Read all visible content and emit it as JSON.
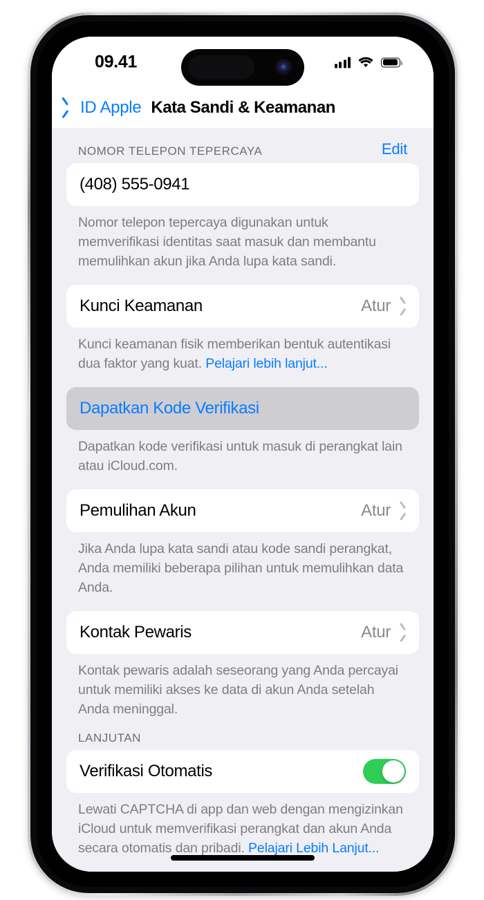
{
  "status_bar": {
    "time": "09.41",
    "icons": [
      "cellular-signal-icon",
      "wifi-icon",
      "battery-icon"
    ]
  },
  "nav_bar": {
    "back_label": "ID Apple",
    "title": "Kata Sandi & Keamanan"
  },
  "sections": {
    "trusted_phone": {
      "header": "NOMOR TELEPON TEPERCAYA",
      "edit_label": "Edit",
      "phone_number": "(408) 555-0941",
      "footnote": "Nomor telepon tepercaya digunakan untuk memverifikasi identitas saat masuk dan membantu memulihkan akun jika Anda lupa kata sandi."
    },
    "security_key": {
      "title": "Kunci Keamanan",
      "value": "Atur",
      "footnote_text": "Kunci keamanan fisik memberikan bentuk autentikasi dua faktor yang kuat. ",
      "footnote_link": "Pelajari lebih lanjut..."
    },
    "verification_code": {
      "title": "Dapatkan Kode Verifikasi",
      "footnote": "Dapatkan kode verifikasi untuk masuk di perangkat lain atau iCloud.com."
    },
    "account_recovery": {
      "title": "Pemulihan Akun",
      "value": "Atur",
      "footnote": "Jika Anda lupa kata sandi atau kode sandi perangkat, Anda memiliki beberapa pilihan untuk memulihkan data Anda."
    },
    "legacy_contact": {
      "title": "Kontak Pewaris",
      "value": "Atur",
      "footnote": "Kontak pewaris adalah seseorang yang Anda percayai untuk memiliki akses ke data di akun Anda setelah Anda meninggal."
    },
    "advanced": {
      "header": "LANJUTAN",
      "auto_verification_title": "Verifikasi Otomatis",
      "auto_verification_state": "on",
      "footnote_text": "Lewati CAPTCHA di app dan web dengan mengizinkan iCloud untuk memverifikasi perangkat dan akun Anda secara otomatis dan pribadi. ",
      "footnote_link": "Pelajari Lebih Lanjut..."
    }
  },
  "colors": {
    "accent_blue": "#0a7cff",
    "switch_green": "#2fcc56",
    "page_background": "#efeff4",
    "card_background": "#ffffff",
    "pressed_row_background": "#cecdd2",
    "secondary_text": "#7d7d82"
  }
}
